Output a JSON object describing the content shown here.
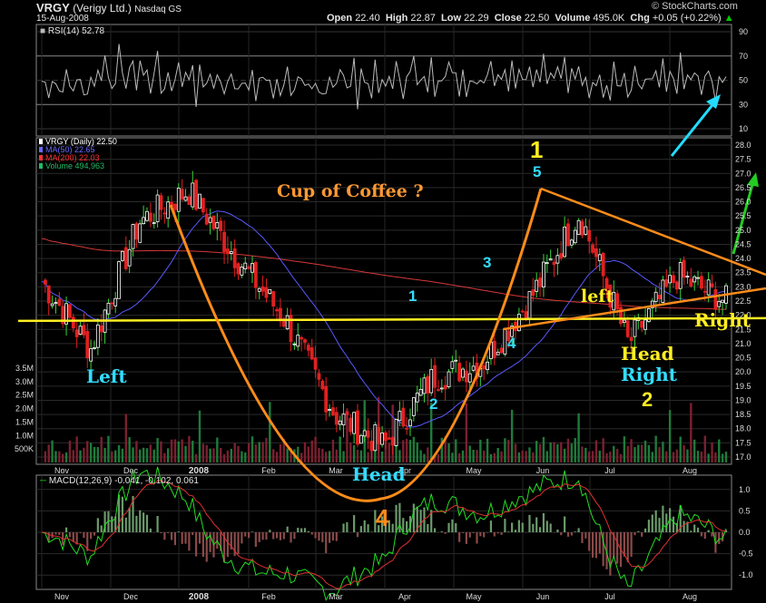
{
  "header": {
    "symbol": "VRGY",
    "company": "(Verigy Ltd.)",
    "exchange": "Nasdaq GS",
    "date": "15-Aug-2008",
    "quote": {
      "open_label": "Open",
      "open": "22.40",
      "high_label": "High",
      "high": "22.87",
      "low_label": "Low",
      "low": "22.29",
      "close_label": "Close",
      "close": "22.50",
      "volume_label": "Volume",
      "volume": "495.0K",
      "chg_label": "Chg",
      "chg": "+0.05 (+0.22%)"
    },
    "watermark": "© StockCharts.com",
    "up_arrow_color": "#00cc00"
  },
  "rsi_panel": {
    "label": "RSI(14)",
    "value": "52.78",
    "ticks": [
      "90",
      "70",
      "50",
      "30",
      "10"
    ]
  },
  "price_panel": {
    "legend": [
      {
        "text": "VRGY (Daily) 22.50",
        "color": "#ffffff",
        "icon": "candle-icon"
      },
      {
        "text": "MA(50) 22.65",
        "color": "#6a6aff",
        "icon": "line-icon"
      },
      {
        "text": "MA(200) 22.03",
        "color": "#ff3030",
        "icon": "line-icon"
      },
      {
        "text": "Volume 494,963",
        "color": "#22bb66",
        "icon": "bar-icon"
      }
    ],
    "price_ticks": [
      "28.0",
      "27.5",
      "27.0",
      "26.5",
      "26.0",
      "25.5",
      "25.0",
      "24.5",
      "24.0",
      "23.5",
      "23.0",
      "22.5",
      "22.0",
      "21.5",
      "21.0",
      "20.5",
      "20.0",
      "19.5",
      "19.0",
      "18.5",
      "18.0",
      "17.5",
      "17.0"
    ],
    "volume_ticks": [
      "3.5M",
      "3.0M",
      "2.5M",
      "2.0M",
      "1.5M",
      "1.0M",
      "500K"
    ]
  },
  "macd_panel": {
    "label": "MACD(12,26,9)",
    "values": "-0.041, -0.102, 0.061",
    "ticks": [
      "1.0",
      "0.5",
      "0.0",
      "-0.5",
      "-1.0"
    ]
  },
  "x_axis": {
    "labels": [
      "Nov",
      "Dec",
      "2008",
      "Feb",
      "Mar",
      "Apr",
      "May",
      "Jun",
      "Jul",
      "Aug"
    ]
  },
  "annotations": {
    "cup_label": "Cup of Coffee ?",
    "left": "Left",
    "head": "Head",
    "num_1_yellow": "1",
    "num_5": "5",
    "num_1_cyan": "1",
    "num_3": "3",
    "num_4_cyan": "4",
    "num_2_cyan": "2",
    "left_small": "left",
    "head_right_1": "Head",
    "head_right_2": "Right",
    "num_2_yellow": "2",
    "right": "Right",
    "num_4_orange": "4"
  },
  "chart_data": {
    "type": "candlestick",
    "symbol": "VRGY",
    "period": "Daily",
    "y_range": [
      17.0,
      28.0
    ],
    "volume_range": [
      0,
      3500000
    ],
    "rsi_range": [
      10,
      90
    ],
    "macd_range": [
      -1.25,
      1.25
    ],
    "x_labels": [
      "Nov",
      "Dec",
      "2008",
      "Feb",
      "Mar",
      "Apr",
      "May",
      "Jun",
      "Jul",
      "Aug"
    ],
    "close_path": [
      {
        "x": "Nov",
        "close": 23.2
      },
      {
        "x": "Nov late",
        "close": 20.8
      },
      {
        "x": "Dec",
        "close": 25.3
      },
      {
        "x": "2008",
        "close": 26.4
      },
      {
        "x": "2008 late",
        "close": 24.0
      },
      {
        "x": "Feb",
        "close": 21.8
      },
      {
        "x": "Mar",
        "close": 18.5
      },
      {
        "x": "Mar late",
        "close": 17.4
      },
      {
        "x": "Apr",
        "close": 19.8
      },
      {
        "x": "Apr late",
        "close": 20.3
      },
      {
        "x": "May",
        "close": 22.6
      },
      {
        "x": "Jun",
        "close": 25.6
      },
      {
        "x": "Jul",
        "close": 21.0
      },
      {
        "x": "Jul late",
        "close": 23.4
      },
      {
        "x": "Aug",
        "close": 22.5
      }
    ],
    "series_legend": [
      {
        "name": "VRGY (Daily)",
        "value": 22.5
      },
      {
        "name": "MA(50)",
        "value": 22.65
      },
      {
        "name": "MA(200)",
        "value": 22.03
      },
      {
        "name": "Volume",
        "value": 494963
      }
    ],
    "rsi": {
      "name": "RSI(14)",
      "value": 52.78
    },
    "macd": {
      "name": "MACD(12,26,9)",
      "values": [
        -0.041,
        -0.102,
        0.061
      ]
    },
    "support_line_level": 21.8
  }
}
